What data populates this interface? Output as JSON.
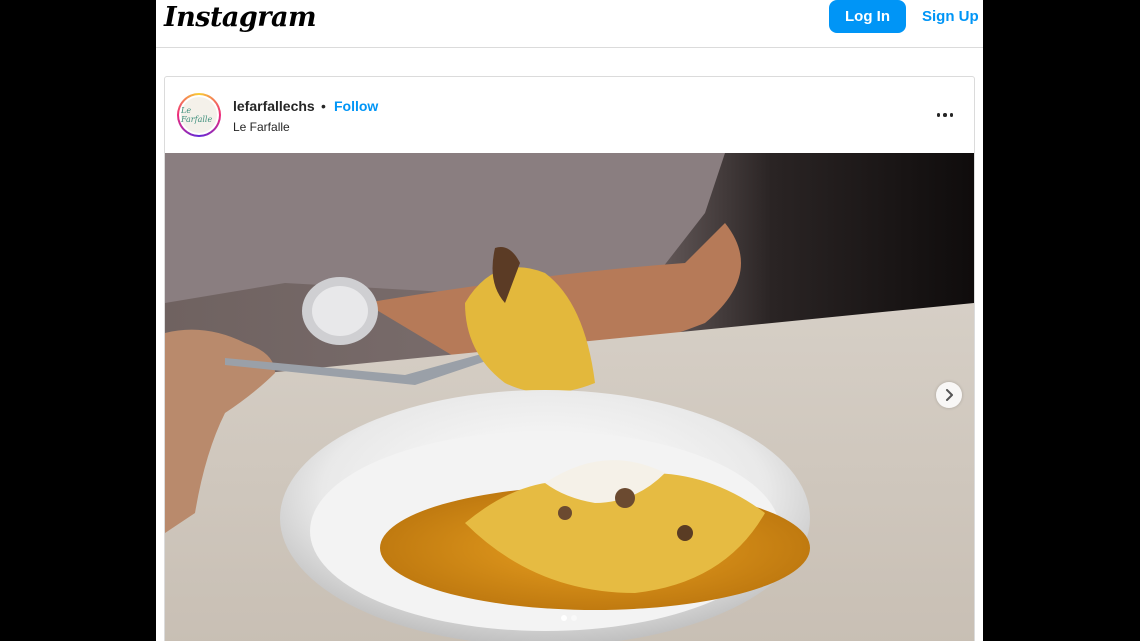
{
  "header": {
    "logo_text": "Instagram",
    "login_label": "Log In",
    "signup_label": "Sign Up"
  },
  "post": {
    "username": "lefarfallechs",
    "separator": "•",
    "follow_label": "Follow",
    "location": "Le Farfalle",
    "avatar_text": "Le Farfalle",
    "image_description_icon": "food-photo",
    "carousel": {
      "total": 2,
      "current": 1
    }
  },
  "colors": {
    "accent": "#0095f6",
    "border": "#dbdbdb",
    "text": "#262626"
  }
}
